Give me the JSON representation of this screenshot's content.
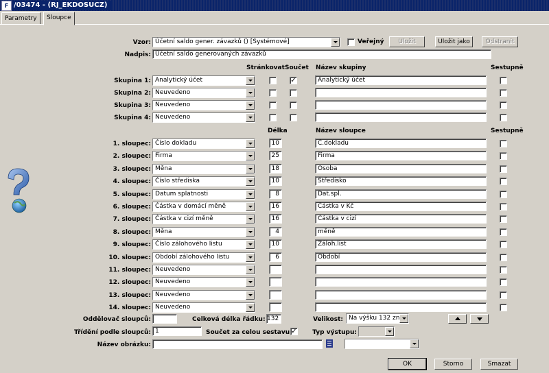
{
  "window": {
    "title": "/03474 - (RJ_EKDOSUCZ)",
    "app_icon_text": "F"
  },
  "tabs": [
    {
      "label": "Parametry"
    },
    {
      "label": "Sloupce"
    }
  ],
  "vzor": {
    "label": "Vzor:",
    "value": "Účetní saldo gener. závazků   ()   [Systémové]",
    "verejny_label": "Veřejný",
    "verejny_checked": false
  },
  "buttons": {
    "ulozit": "Uložit",
    "ulozit_jako": "Uložit jako",
    "odstranit": "Odstranit",
    "ok": "OK",
    "storno": "Storno",
    "smazat": "Smazat"
  },
  "nadpis": {
    "label": "Nadpis:",
    "value": "Účetní saldo generovaných závazků"
  },
  "group_headers": {
    "strankovat": "Stránkovat",
    "soucet": "Součet",
    "nazev_skupiny": "Název skupiny",
    "sestupne": "Sestupně"
  },
  "groups": [
    {
      "label": "Skupina 1:",
      "value": "Analytický účet",
      "strankovat": false,
      "soucet": true,
      "name": "Analytický účet",
      "sestupne": false
    },
    {
      "label": "Skupina 2:",
      "value": "Neuvedeno",
      "strankovat": false,
      "soucet": false,
      "name": "",
      "sestupne": false
    },
    {
      "label": "Skupina 3:",
      "value": "Neuvedeno",
      "strankovat": false,
      "soucet": false,
      "name": "",
      "sestupne": false
    },
    {
      "label": "Skupina 4:",
      "value": "Neuvedeno",
      "strankovat": false,
      "soucet": false,
      "name": "",
      "sestupne": false
    }
  ],
  "column_headers": {
    "delka": "Délka",
    "nazev_sloupce": "Název sloupce",
    "sestupne": "Sestupně"
  },
  "columns": [
    {
      "label": "1. sloupec:",
      "value": "Číslo dokladu",
      "length": "10",
      "name": "Č.dokladu"
    },
    {
      "label": "2. sloupec:",
      "value": "Firma",
      "length": "25",
      "name": "Firma"
    },
    {
      "label": "3. sloupec:",
      "value": "Měna",
      "length": "18",
      "name": "Osoba"
    },
    {
      "label": "4. sloupec:",
      "value": "Číslo střediska",
      "length": "10",
      "name": "Středisko"
    },
    {
      "label": "5. sloupec:",
      "value": "Datum splatnosti",
      "length": "8",
      "name": "Dat.spl."
    },
    {
      "label": "6. sloupec:",
      "value": "Částka v domácí měně",
      "length": "16",
      "name": "Částka v Kč"
    },
    {
      "label": "7. sloupec:",
      "value": "Částka v cizí měně",
      "length": "16",
      "name": "Částka v cizí"
    },
    {
      "label": "8. sloupec:",
      "value": "Měna",
      "length": "4",
      "name": "měně"
    },
    {
      "label": "9. sloupec:",
      "value": "Číslo zálohového listu",
      "length": "10",
      "name": "Záloh.list"
    },
    {
      "label": "10. sloupec:",
      "value": "Období zálohového listu",
      "length": "6",
      "name": "Období"
    },
    {
      "label": "11. sloupec:",
      "value": "Neuvedeno",
      "length": "",
      "name": ""
    },
    {
      "label": "12. sloupec:",
      "value": "Neuvedeno",
      "length": "",
      "name": ""
    },
    {
      "label": "13. sloupec:",
      "value": "Neuvedeno",
      "length": "",
      "name": ""
    },
    {
      "label": "14. sloupec:",
      "value": "Neuvedeno",
      "length": "",
      "name": ""
    }
  ],
  "footer": {
    "oddelovac_label": "Oddělovač sloupců:",
    "oddelovac_value": "",
    "celkova_label": "Celková délka řádku:",
    "celkova_value": "132",
    "velikost_label": "Velikost:",
    "velikost_value": "Na výšku 132 zn.",
    "trideni_label": "Třídění podle sloupců:",
    "trideni_value": "1",
    "soucet_label": "Součet za celou sestavu:",
    "soucet_checked": true,
    "typ_label": "Typ výstupu:",
    "typ_value": "",
    "obrazek_label": "Název obrázku:",
    "obrazek_value": "",
    "obrazek_combo": ""
  },
  "icons": {
    "help": "help-question-icon",
    "list": "list-picker-icon",
    "up": "arrow-up-icon",
    "down": "arrow-down-icon"
  }
}
